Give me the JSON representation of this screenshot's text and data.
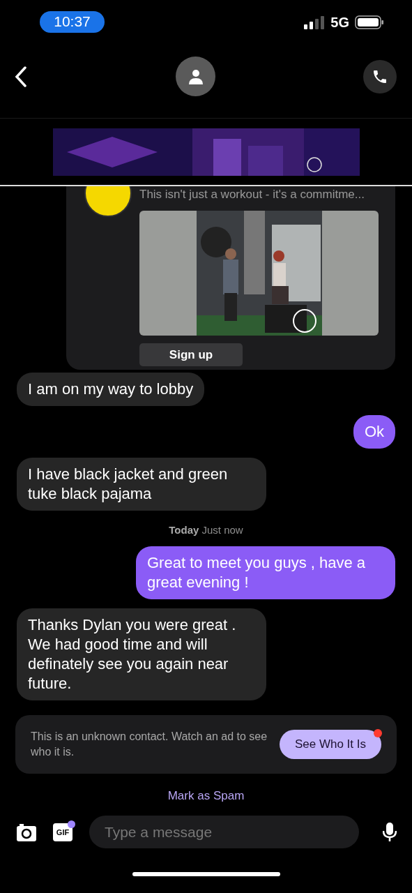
{
  "status_bar": {
    "time": "10:37",
    "network": "5G"
  },
  "sponsored_card": {
    "description": "This isn't just a workout - it's a commitme...",
    "button": "Sign up"
  },
  "messages": [
    {
      "kind": "incoming",
      "text": "I am on my way to lobby"
    },
    {
      "kind": "outgoing",
      "text": "Ok"
    },
    {
      "kind": "incoming",
      "text": "I have black jacket and green tuke black pajama"
    },
    {
      "kind": "timestamp",
      "text": "**Today** Just now"
    },
    {
      "kind": "outgoing",
      "text": "Great to meet you guys , have a great evening !"
    },
    {
      "kind": "incoming",
      "text": "Thanks Dylan you were great . We had good time and will definately see you again near future."
    }
  ],
  "unknown_contact": {
    "text": "This is an unknown contact. Watch an ad to see who it is.",
    "button": "See Who It Is",
    "notification": true
  },
  "spam_link": "Mark as Spam",
  "composer": {
    "gif_label": "GIF",
    "gif_badge": true,
    "placeholder": "Type a message"
  }
}
